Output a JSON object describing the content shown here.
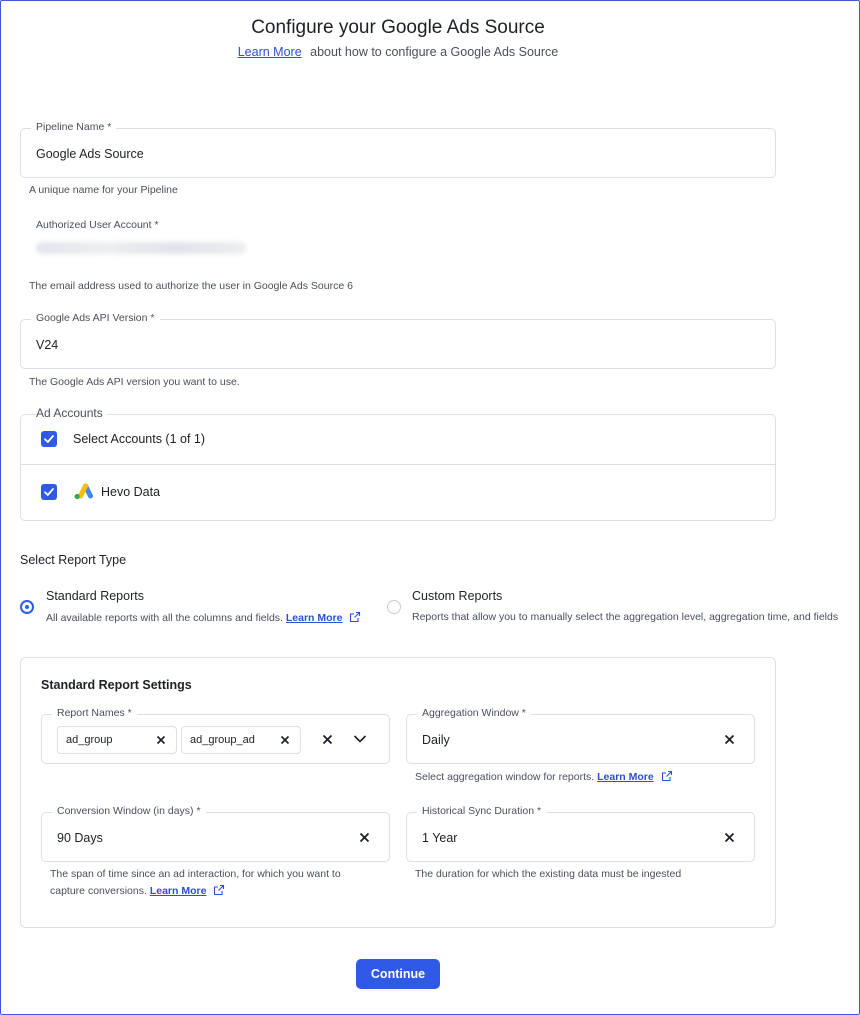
{
  "header": {
    "title": "Configure your Google Ads Source",
    "learn_more": "Learn More",
    "subtitle_rest": "about how to configure a Google Ads Source"
  },
  "pipeline_name": {
    "label": "Pipeline Name *",
    "value": "Google Ads Source",
    "helper": "A unique name for your Pipeline"
  },
  "authorized_user": {
    "label": "Authorized User Account *",
    "helper": "The email address used to authorize the user in Google Ads Source 6"
  },
  "api_version": {
    "label": "Google Ads API Version *",
    "value": "V24",
    "helper": "The Google Ads API version you want to use."
  },
  "ad_accounts": {
    "label": "Ad Accounts",
    "select_all": "Select Accounts (1 of 1)",
    "items": [
      {
        "name": "Hevo Data",
        "icon": "google-ads-icon"
      }
    ]
  },
  "report_type": {
    "heading": "Select Report Type",
    "standard": {
      "title": "Standard Reports",
      "desc": "All available reports with all the columns and fields.",
      "learn_more": "Learn More",
      "selected": true
    },
    "custom": {
      "title": "Custom Reports",
      "desc": "Reports that allow you to manually select the aggregation level, aggregation time, and fields",
      "selected": false
    }
  },
  "settings": {
    "title": "Standard Report Settings",
    "report_names": {
      "label": "Report Names *",
      "chips": [
        "ad_group",
        "ad_group_ad"
      ]
    },
    "aggregation_window": {
      "label": "Aggregation Window *",
      "value": "Daily",
      "helper": "Select aggregation window for reports.",
      "learn_more": "Learn More"
    },
    "conversion_window": {
      "label": "Conversion Window (in days) *",
      "value": "90 Days",
      "helper_line1": "The span of time since an ad interaction, for which you want to",
      "helper_line2": "capture conversions.",
      "learn_more": "Learn More"
    },
    "historical_sync": {
      "label": "Historical Sync Duration *",
      "value": "1 Year",
      "helper": "The duration for which the existing data must be ingested"
    }
  },
  "actions": {
    "continue": "Continue"
  },
  "colors": {
    "accent": "#2f5ae5",
    "link": "#2b4fd8",
    "border": "#dcdfe6"
  }
}
